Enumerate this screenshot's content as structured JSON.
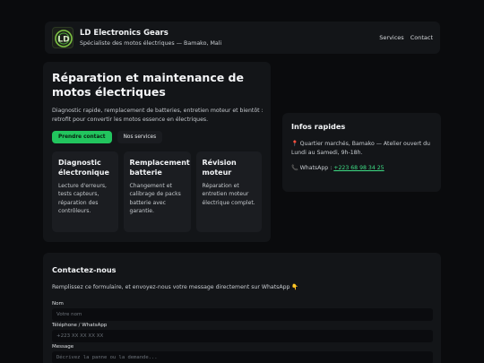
{
  "header": {
    "brand_title": "LD Electronics Gears",
    "brand_subtitle": "Spécialiste des motos électriques — Bamako, Mali",
    "nav": [
      "Services",
      "Contact"
    ]
  },
  "hero": {
    "title": "Réparation et maintenance de motos électriques",
    "description": "Diagnostic rapide, remplacement de batteries, entretien moteur et bientôt : retrofit pour convertir les motos essence en électriques.",
    "primary_button": "Prendre contact",
    "secondary_button": "Nos services",
    "cards": [
      {
        "title": "Diagnostic électronique",
        "text": "Lecture d'erreurs, tests capteurs, réparation des contrôleurs."
      },
      {
        "title": "Remplacement batterie",
        "text": "Changement et calibrage de packs batterie avec garantie."
      },
      {
        "title": "Révision moteur",
        "text": "Réparation et entretien moteur électrique complet."
      }
    ]
  },
  "info": {
    "title": "Infos rapides",
    "address": "📍 Quartier marchés, Bamako — Atelier ouvert du Lundi au Samedi, 9h-18h.",
    "whatsapp_label": "📞 WhatsApp : ",
    "whatsapp_number": "+223 68 98 34 25"
  },
  "contact": {
    "title": "Contactez-nous",
    "intro": "Remplissez ce formulaire, et envoyez-nous votre message directement sur WhatsApp 👇",
    "fields": [
      {
        "label": "Nom",
        "placeholder": "Votre nom"
      },
      {
        "label": "Téléphone / WhatsApp",
        "placeholder": "+223 XX XX XX XX"
      },
      {
        "label": "Message",
        "placeholder": "Décrivez la panne ou la demande..."
      }
    ]
  },
  "colors": {
    "accent": "#22c55e",
    "link": "#3ddc84",
    "background": "#0a0b0d",
    "panel": "#131518"
  }
}
